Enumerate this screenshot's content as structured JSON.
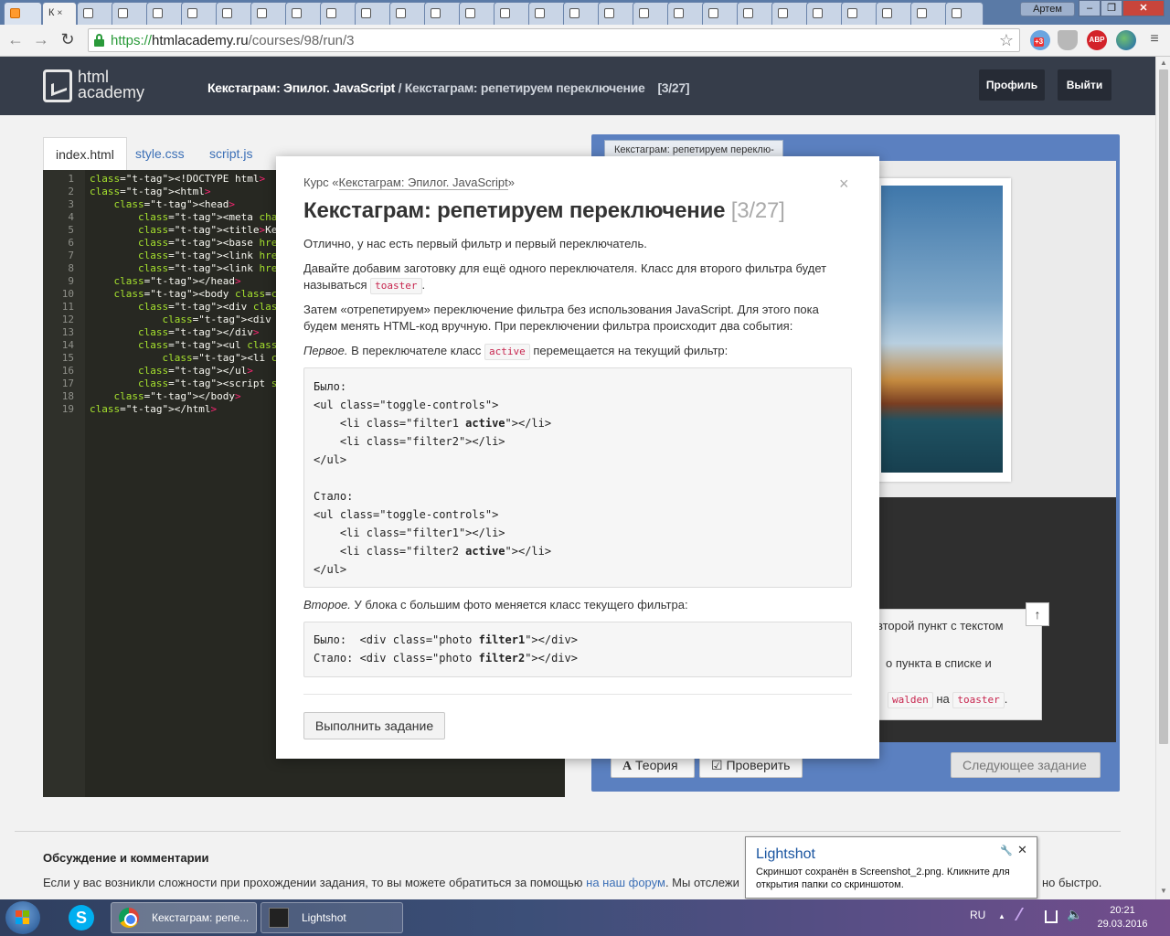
{
  "browser": {
    "active_tab_title": "К",
    "tab_close": "×",
    "window_user": "Артем",
    "window_minimize": "–",
    "window_restore": "❐",
    "window_close": "✕",
    "url": {
      "scheme": "https://",
      "host": "htmlacademy.ru",
      "path": "/courses/98/run/3"
    },
    "nav": {
      "back": "←",
      "forward": "→",
      "reload": "↻"
    },
    "star": "☆",
    "ext_badge_count": "+3",
    "ext_abp": "ABP"
  },
  "site": {
    "logo_line1": "html",
    "logo_line2": "academy",
    "crumb_course": "Кекстаграм: Эпилог. JavaScript",
    "crumb_sep": " / ",
    "crumb_task": "Кекстаграм: репетируем переключение",
    "crumb_step": "[3/27]",
    "profile_button": "Профиль",
    "logout_button": "Выйти"
  },
  "editor": {
    "tabs": [
      "index.html",
      "style.css",
      "script.js"
    ],
    "lines": [
      {
        "n": "1",
        "code": "<!DOCTYPE html>"
      },
      {
        "n": "2",
        "code": "<html>"
      },
      {
        "n": "3",
        "code": "    <head>"
      },
      {
        "n": "4",
        "code": "        <meta charset=\"utf-8\">"
      },
      {
        "n": "5",
        "code": "        <title>Кекстаграм: репе"
      },
      {
        "n": "6",
        "code": "        <base href=\"/assets/cou"
      },
      {
        "n": "7",
        "code": "        <link href=\"style.css\""
      },
      {
        "n": "8",
        "code": "        <link href=\"course.css\""
      },
      {
        "n": "9",
        "code": "    </head>"
      },
      {
        "n": "10",
        "code": "    <body class=\"keksta\">"
      },
      {
        "n": "11",
        "code": "        <div class=\"photos\">"
      },
      {
        "n": "12",
        "code": "            <div class=\"photo w"
      },
      {
        "n": "13",
        "code": "        </div>"
      },
      {
        "n": "14",
        "code": "        <ul class=\"toggle-contr"
      },
      {
        "n": "15",
        "code": "            <li class=\"walden a"
      },
      {
        "n": "16",
        "code": "        </ul>"
      },
      {
        "n": "17",
        "code": "        <script src=\"script.js\""
      },
      {
        "n": "18",
        "code": "    </body>"
      },
      {
        "n": "19",
        "code": "</html>"
      }
    ]
  },
  "preview": {
    "tab_title": "Кекстаграм: репетируем переклю-",
    "task_line1": "второй пункт с текстом",
    "task_line2": "о пункта в списке и",
    "task_from": "walden",
    "task_on": "на",
    "task_to": "toaster",
    "task_dot": ".",
    "up_arrow": "↑",
    "theory_button": "Теория",
    "check_button": "Проверить",
    "next_button": "Следующее задание"
  },
  "modal": {
    "course_prefix": "Курс «",
    "course_link": "Кекстаграм: Эпилог. JavaScript",
    "course_suffix": "»",
    "close": "×",
    "title": "Кекстаграм: репетируем переключение",
    "step": "[3/27]",
    "p1": "Отлично, у нас есть первый фильтр и первый переключатель.",
    "p2": "Давайте добавим заготовку для ещё одного переключателя. Класс для второго фильтра будет называться",
    "p2_code": "toaster",
    "p2_end": ".",
    "p3": "Затем «отрепетируем» переключение фильтра без использования JavaScript. Для этого пока будем менять HTML-код вручную. При переключении фильтра происходит два события:",
    "p4_em": "Первое.",
    "p4": " В переключателе класс",
    "p4_code": "active",
    "p4_end": "перемещается на текущий фильтр:",
    "code1": [
      "Было:",
      "<ul class=\"toggle-controls\">",
      "    <li class=\"filter1 active\"></li>",
      "    <li class=\"filter2\"></li>",
      "</ul>",
      "",
      "Стало:",
      "<ul class=\"toggle-controls\">",
      "    <li class=\"filter1\"></li>",
      "    <li class=\"filter2 active\"></li>",
      "</ul>"
    ],
    "p5_em": "Второе.",
    "p5": " У блока с большим фото меняется класс текущего фильтра:",
    "code2": [
      "Было:  <div class=\"photo filter1\"></div>",
      "Стало: <div class=\"photo filter2\"></div>"
    ],
    "button": "Выполнить задание"
  },
  "discussion": {
    "title": "Обсуждение и комментарии",
    "text": "Если у вас возникли сложности при прохождении задания, то вы можете обратиться за помощью ",
    "link": "на наш форум",
    "text2": ". Мы отслежи",
    "end": "но быстро."
  },
  "lightshot": {
    "title": "Lightshot",
    "text": "Скриншот сохранён в Screenshot_2.png. Кликните для открытия папки со скриншотом.",
    "pin": "🔧",
    "close": "✕"
  },
  "taskbar": {
    "skype": "S",
    "chrome_item": "Кекстаграм: репе...",
    "lightshot_item": "Lightshot",
    "lang": "RU",
    "tray_arrow": "▲",
    "time": "20:21",
    "date": "29.03.2016"
  },
  "colors": {
    "header": "#363d4a",
    "preview": "#5b80c0",
    "editor_bg": "#272822",
    "link": "#3b6fb6"
  }
}
